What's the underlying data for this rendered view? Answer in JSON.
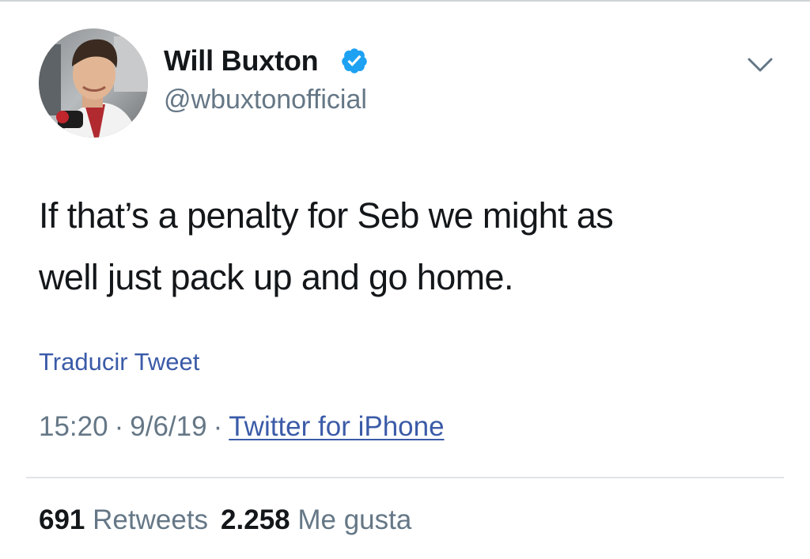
{
  "author": {
    "name": "Will Buxton",
    "handle": "@wbuxtonofficial",
    "verified": true,
    "avatar_icon": "profile-photo",
    "verified_icon": "verified-badge-icon",
    "menu_icon": "chevron-down-icon"
  },
  "tweet": {
    "text_line1": "If that’s a penalty for Seb we might as",
    "text_line2": "well just pack up and go home.",
    "translate_label": "Traducir Tweet",
    "time": "15:20",
    "separator": "·",
    "date": "9/6/19",
    "source": "Twitter for iPhone"
  },
  "stats": {
    "retweets_count": "691",
    "retweets_label": "Retweets",
    "likes_count": "2.258",
    "likes_label": "Me gusta"
  },
  "colors": {
    "text": "#14171a",
    "secondary": "#657786",
    "link": "#3b5ba8",
    "verified": "#1da1f2",
    "divider": "#e1e4e7"
  }
}
